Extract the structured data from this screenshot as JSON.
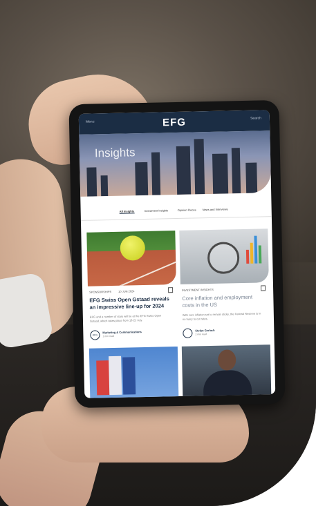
{
  "app": {
    "logo": "EFG",
    "nav_left": "Menu",
    "nav_right": "Search"
  },
  "hero": {
    "title": "Insights"
  },
  "tabs": [
    {
      "label": "All Insights",
      "active": true
    },
    {
      "label": "Investment Insights",
      "active": false
    },
    {
      "label": "Opinion Pieces",
      "active": false
    },
    {
      "label": "News and Interviews",
      "active": false
    }
  ],
  "cards": [
    {
      "meta": "SPONSORSHIPS",
      "date": "10 JUN 2024",
      "title": "EFG Swiss Open Gstaad reveals an impressive line-up for 2024",
      "excerpt": "EFG and a number of stars will be at the EFG Swiss Open Gstaad, which takes place from 13-21 July.",
      "author_initials": "EFG",
      "author_name": "Marketing & Communications",
      "author_sub": "1 min read"
    },
    {
      "meta": "INVESTMENT INSIGHTS",
      "date": "",
      "title": "Core inflation and employment costs in the US",
      "excerpt": "With core inflation set to remain sticky, the Federal Reserve is in no hurry to cut rates.",
      "author_initials": "",
      "author_name": "Stefan Gerlach",
      "author_sub": "2 min read"
    }
  ],
  "colors": {
    "brand_navy": "#1b2d44",
    "background": "#ffffff"
  }
}
